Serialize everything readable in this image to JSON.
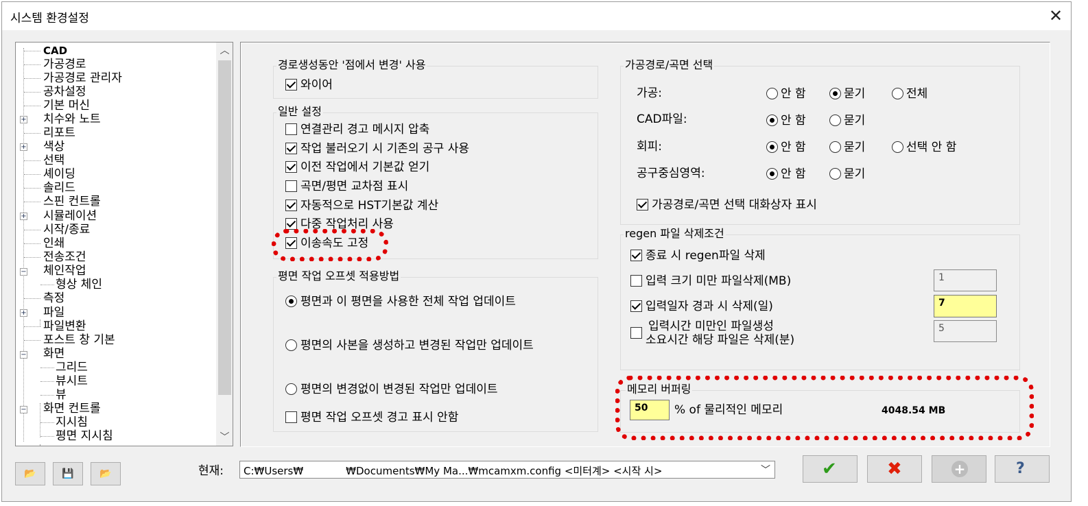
{
  "window": {
    "title": "시스템 환경설정"
  },
  "tree": {
    "items": [
      "CAD",
      "가공경로",
      "가공경로 관리자",
      "공차설정",
      "기본 머신",
      "치수와 노트",
      "리포트",
      "색상",
      "선택",
      "셰이딩",
      "솔리드",
      "스핀 컨트롤",
      "시뮬레이션",
      "시작/종료",
      "인쇄",
      "전송조건",
      "체인작업",
      "형상 체인",
      "측정",
      "파일",
      "파일변환",
      "포스트 창 기본",
      "화면",
      "그리드",
      "뷰시트",
      "뷰",
      "화면 컨트롤",
      "지시침",
      "평면 지시침"
    ]
  },
  "toolpath_group": {
    "title": "경로생성동안 '점에서 변경' 사용",
    "wire": "와이어",
    "wire_checked": true
  },
  "general": {
    "title": "일반 설정",
    "items": [
      {
        "label": "연결관리 경고 메시지 압축",
        "checked": false
      },
      {
        "label": "작업 불러오기 시 기존의 공구 사용",
        "checked": true
      },
      {
        "label": "이전 작업에서 기본값 얻기",
        "checked": true
      },
      {
        "label": "곡면/평면 교차점 표시",
        "checked": false
      },
      {
        "label": "자동적으로 HST기본값 계산",
        "checked": true
      },
      {
        "label": "다중 작업처리 사용",
        "checked": true
      },
      {
        "label": "이송속도 고정",
        "checked": true
      }
    ]
  },
  "offset": {
    "title": "평면 작업 오프셋 적용방법",
    "opt1": "평면과 이 평면을 사용한 전체 작업 업데이트",
    "opt2": "평면의 사본을 생성하고 변경된 작업만 업데이트",
    "opt3": "평면의 변경없이 변경된 작업만 업데이트",
    "warn": "평면 작업 오프셋 경고 표시 안함",
    "selected": 1
  },
  "select": {
    "title": "가공경로/곡면 선택",
    "r1": {
      "label": "가공:",
      "o1": "안 함",
      "o2": "묻기",
      "o3": "전체",
      "selected": 2
    },
    "r2": {
      "label": "CAD파일:",
      "o1": "안 함",
      "o2": "묻기",
      "selected": 1
    },
    "r3": {
      "label": "회피:",
      "o1": "안 함",
      "o2": "묻기",
      "o3": "선택 안 함",
      "selected": 1
    },
    "r4": {
      "label": "공구중심영역:",
      "o1": "안 함",
      "o2": "묻기",
      "selected": 1
    },
    "dialog": "가공경로/곡면 선택 대화상자 표시",
    "dialog_checked": true
  },
  "regen": {
    "title": "regen 파일 삭제조건",
    "c1": "종료 시 regen파일 삭제",
    "c2": "입력 크기 미만 파일삭제(MB)",
    "c2v": "1",
    "c3": "입력일자 경과 시 삭제(일)",
    "c3v": "7",
    "c4a": "입력시간 미만인 파일생성",
    "c4b": "소요시간 해당 파일은 삭제(분)",
    "c4v": "5"
  },
  "memory": {
    "title": "메모리 버퍼링",
    "value": "50",
    "unit": "% of 물리적인 메모리",
    "total": "4048.54 MB"
  },
  "current": {
    "label": "현재:",
    "path": "C:₩Users₩             ₩Documents₩My Ma...₩mcamxm.config <미터계> <시작 시>"
  },
  "colors": {
    "highlight": "#e00000",
    "input_active": "#ffff99"
  }
}
